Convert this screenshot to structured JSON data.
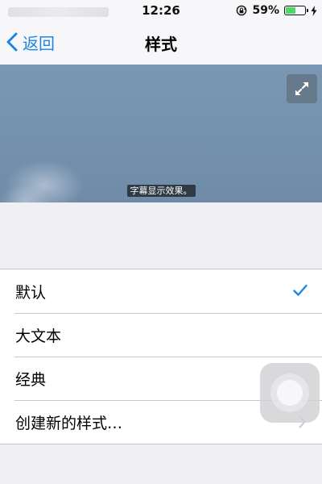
{
  "status_bar": {
    "time": "12:26",
    "battery_percent_label": "59%",
    "battery_level": 0.59,
    "icons": [
      "rotation-lock-icon",
      "battery-icon",
      "charging-bolt-icon"
    ]
  },
  "nav": {
    "back_label": "返回",
    "title": "样式",
    "back_icon": "chevron-left-icon"
  },
  "preview": {
    "subtitle_text": "字幕显示效果。",
    "fullscreen_icon": "expand-icon"
  },
  "styles_list": {
    "items": [
      {
        "label": "默认",
        "selected": true
      },
      {
        "label": "大文本",
        "selected": false
      },
      {
        "label": "经典",
        "selected": false
      },
      {
        "label": "创建新的样式…",
        "disclosure": true
      }
    ]
  },
  "colors": {
    "accent": "#1b86e6",
    "battery_fill": "#4cd964"
  }
}
